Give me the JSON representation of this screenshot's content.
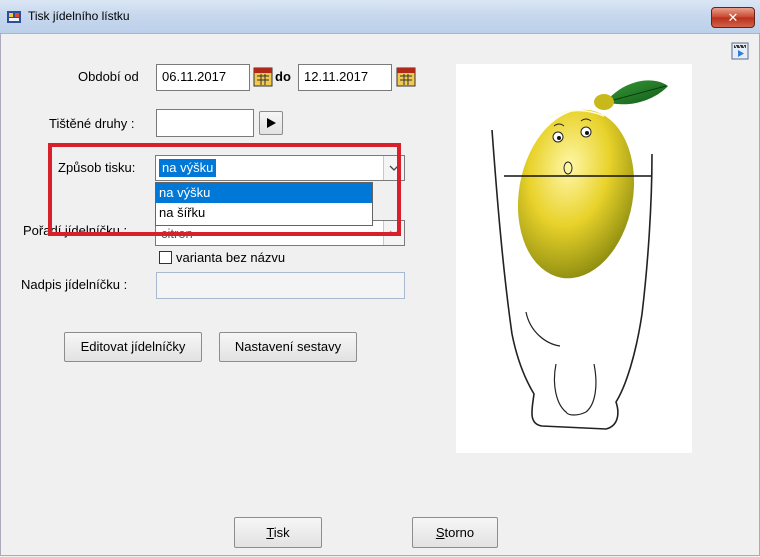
{
  "window": {
    "title": "Tisk jídelního lístku",
    "close_glyph": "✕"
  },
  "period": {
    "label": "Období od",
    "from": "06.11.2017",
    "to_label": "do",
    "to": "12.11.2017"
  },
  "printed_types": {
    "label": "Tištěné druhy :",
    "value": ""
  },
  "print_mode": {
    "label": "Způsob tisku:",
    "selected": "na výšku",
    "options": [
      "na výšku",
      "na šířku"
    ]
  },
  "menu_order": {
    "label": "Pořadí jídelníčku :",
    "value": "citron"
  },
  "no_name_variant": {
    "label": "varianta bez názvu",
    "checked": false
  },
  "menu_heading": {
    "label": "Nadpis jídelníčku :",
    "value": ""
  },
  "buttons": {
    "edit_menus": "Editovat jídelníčky",
    "report_settings": "Nastavení sestavy",
    "print_mnemonic": "T",
    "print_rest": "isk",
    "cancel_mnemonic": "S",
    "cancel_rest": "torno"
  },
  "icons": {
    "app": "menu-app-icon",
    "calendar": "calendar-icon",
    "arrow": "play-arrow-icon",
    "film": "film-clapper-icon"
  },
  "colors": {
    "highlight": "#d8202a",
    "selection": "#0078d7"
  }
}
